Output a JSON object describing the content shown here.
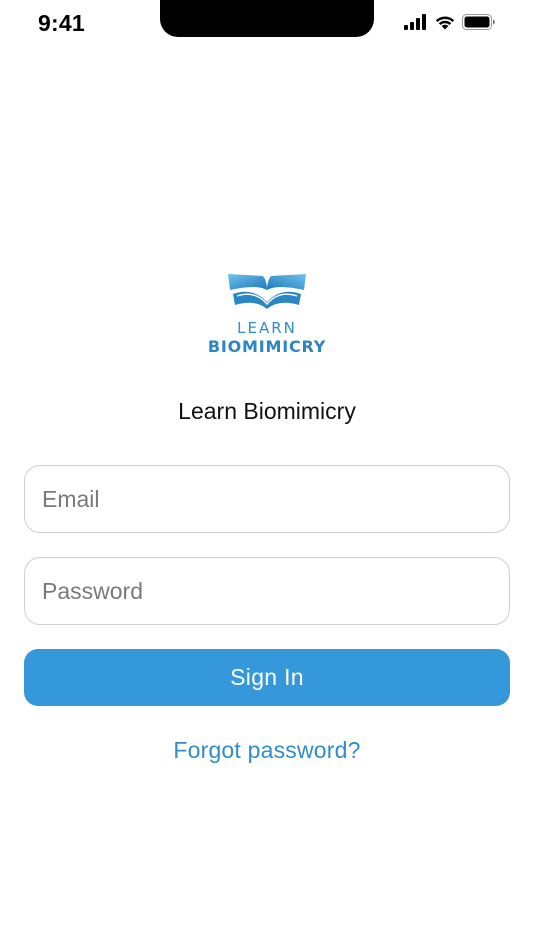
{
  "status_bar": {
    "time": "9:41",
    "icons": [
      "cellular-signal-icon",
      "wifi-icon",
      "battery-icon"
    ]
  },
  "logo": {
    "line1": "LEARN",
    "line2": "BIOMIMICRY",
    "icon": "open-book-wings-icon"
  },
  "app_title": "Learn Biomimicry",
  "form": {
    "email_placeholder": "Email",
    "email_value": "",
    "password_placeholder": "Password",
    "password_value": "",
    "sign_in_label": "Sign In",
    "forgot_password_label": "Forgot password?"
  },
  "colors": {
    "accent": "#3498db",
    "link": "#2f8ec9",
    "logo_blue": "#2a87c4",
    "field_border": "#cfcfcf"
  }
}
